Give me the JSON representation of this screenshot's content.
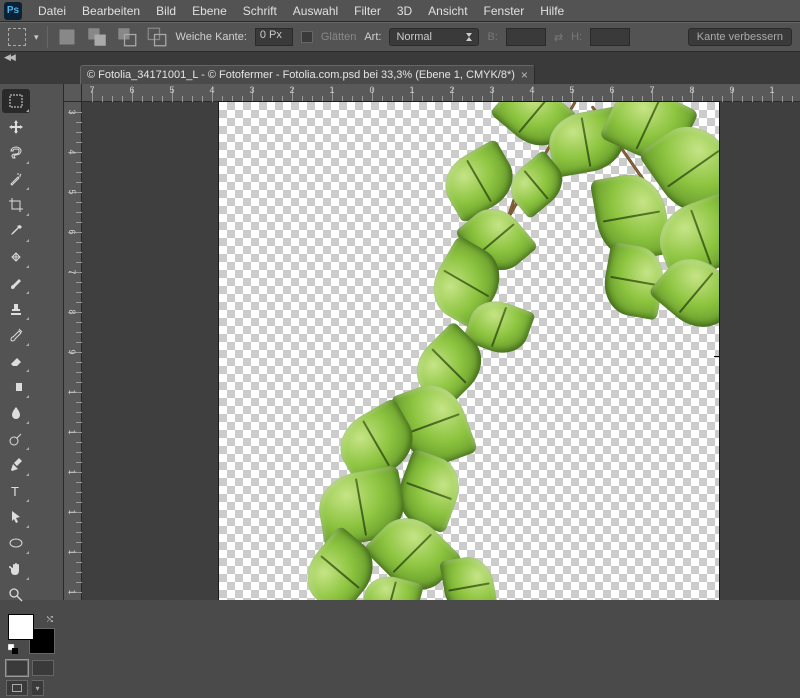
{
  "app": {
    "logo": "Ps"
  },
  "menu": [
    "Datei",
    "Bearbeiten",
    "Bild",
    "Ebene",
    "Schrift",
    "Auswahl",
    "Filter",
    "3D",
    "Ansicht",
    "Fenster",
    "Hilfe"
  ],
  "optbar": {
    "weiche_kante_label": "Weiche Kante:",
    "weiche_kante_value": "0 Px",
    "glaetten_label": "Glätten",
    "art_label": "Art:",
    "art_value": "Normal",
    "b_label": "B:",
    "h_label": "H:",
    "right_btn": "Kante verbessern"
  },
  "tab": {
    "title": "© Fotolia_34171001_L - © Fotofermer - Fotolia.com.psd bei 33,3% (Ebene 1, CMYK/8*)"
  },
  "ruler_h": [
    "7",
    "6",
    "5",
    "4",
    "3",
    "2",
    "1",
    "0",
    "1",
    "2",
    "3",
    "4",
    "5",
    "6",
    "7",
    "8",
    "9",
    "1"
  ],
  "ruler_v": [
    "3",
    "4",
    "5",
    "6",
    "7",
    "8",
    "9",
    "1",
    "1",
    "1",
    "1",
    "1",
    "1"
  ]
}
